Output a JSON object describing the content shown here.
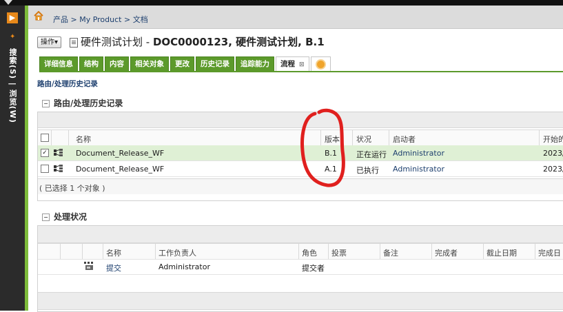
{
  "breadcrumb": [
    "产品",
    "My Product",
    "文档"
  ],
  "breadcrumb_sep": ">",
  "sidebar": {
    "label": "搜索(S) | 浏览(W)"
  },
  "header": {
    "actions_label": "操作",
    "doc_name": "硬件测试计划",
    "doc_title_sep": " - ",
    "doc_id_bold": "DOC0000123, 硬件测试计划, B.1"
  },
  "tabs": [
    {
      "label": "详细信息"
    },
    {
      "label": "结构"
    },
    {
      "label": "内容"
    },
    {
      "label": "相关对象"
    },
    {
      "label": "更改"
    },
    {
      "label": "历史记录"
    },
    {
      "label": "追踪能力"
    },
    {
      "label": "流程",
      "active": true,
      "close": "⊠"
    }
  ],
  "page_subtitle": "路由/处理历史记录",
  "routing": {
    "title": "路由/处理历史记录",
    "columns": [
      "名称",
      "版本",
      "状况",
      "启动者",
      "开始的"
    ],
    "rows": [
      {
        "name": "Document_Release_WF",
        "version": "B.1",
        "status": "正在运行",
        "initiator": "Administrator",
        "start": "2023/",
        "selected": true
      },
      {
        "name": "Document_Release_WF",
        "version": "A.1",
        "status": "已执行",
        "initiator": "Administrator",
        "start": "2023/",
        "selected": false
      }
    ],
    "footer": "( 已选择 1 个对象 )"
  },
  "process": {
    "title": "处理状况",
    "columns": [
      "名称",
      "工作负责人",
      "角色",
      "投票",
      "备注",
      "完成者",
      "截止日期",
      "完成日"
    ],
    "rows": [
      {
        "name": "提交",
        "owner": "Administrator",
        "role": "提交者"
      }
    ]
  },
  "colors": {
    "accent_green": "#5c9a2b",
    "annotation_red": "#e0201e",
    "rail": "#2b2b2b"
  }
}
